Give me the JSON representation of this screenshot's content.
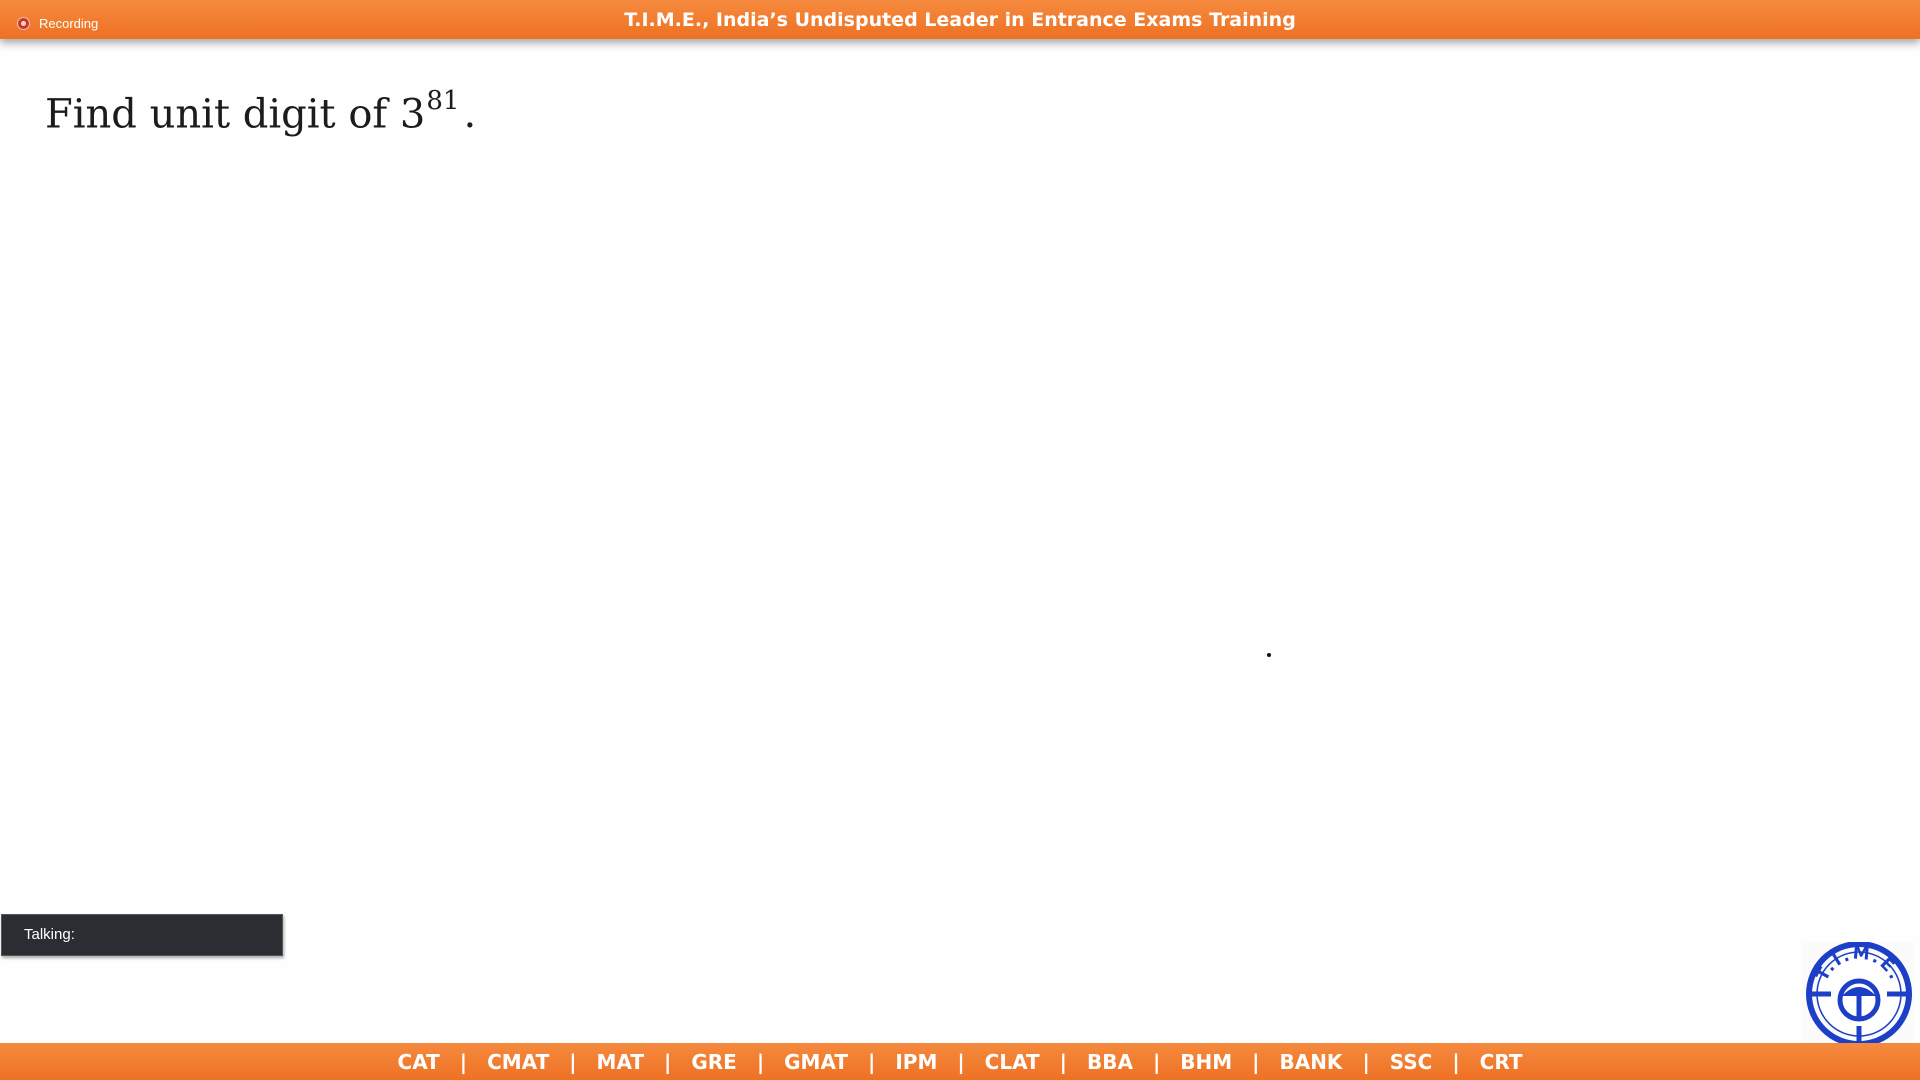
{
  "top_bar": {
    "recording_label": "Recording",
    "title": "T.I.M.E., India’s Undisputed Leader in Entrance Exams Training"
  },
  "question": {
    "prefix": "Find unit digit of 3",
    "exponent": "81",
    "suffix": "."
  },
  "talking_panel": {
    "label": "Talking:"
  },
  "logo": {
    "text": "T.I.M.E.",
    "icon": "time-logo-icon"
  },
  "bottom_bar": {
    "separator": "|",
    "exams": [
      "CAT",
      "CMAT",
      "MAT",
      "GRE",
      "GMAT",
      "IPM",
      "CLAT",
      "BBA",
      "BHM",
      "BANK",
      "SSC",
      "CRT"
    ]
  },
  "colors": {
    "banner_orange": "#f27c30",
    "logo_blue": "#1d3fc8",
    "talking_bg": "#2a2e33",
    "recording_red": "#c8382c"
  }
}
